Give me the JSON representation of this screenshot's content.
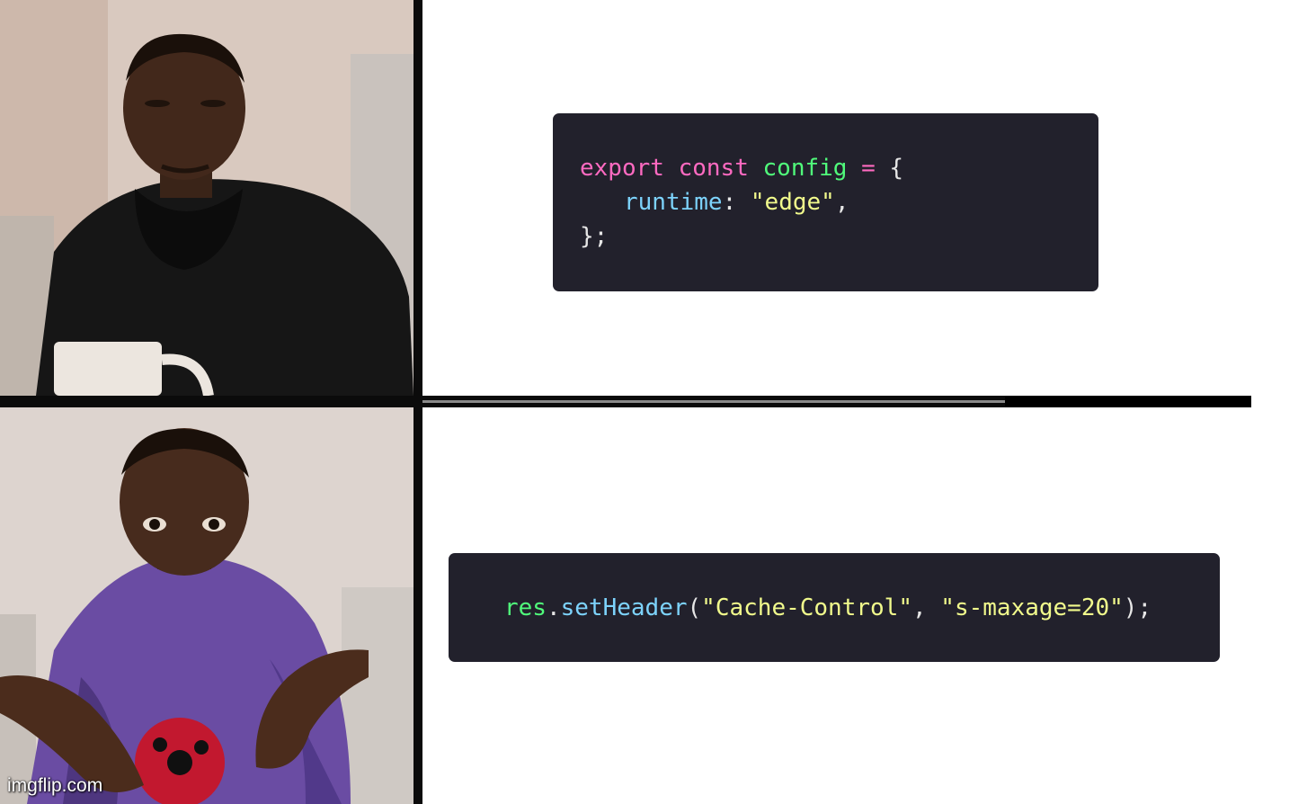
{
  "watermark": "imgflip.com",
  "code_top": {
    "line1": {
      "kw1": "export",
      "kw2": "const",
      "name": "config",
      "op": "=",
      "brace": "{"
    },
    "line2": {
      "prop": "runtime",
      "colon": ":",
      "str": "\"edge\"",
      "comma": ","
    },
    "line3": {
      "close": "};"
    }
  },
  "code_bottom": {
    "obj": "res",
    "dot": ".",
    "method": "setHeader",
    "open": "(",
    "arg1": "\"Cache-Control\"",
    "comma": ",",
    "arg2": "\"s-maxage=20\"",
    "close": ");"
  },
  "colors": {
    "code_bg": "#22212c",
    "keyword": "#ff6ac1",
    "function": "#50fa7b",
    "property": "#7dd3fc",
    "string": "#f1fa8c"
  }
}
